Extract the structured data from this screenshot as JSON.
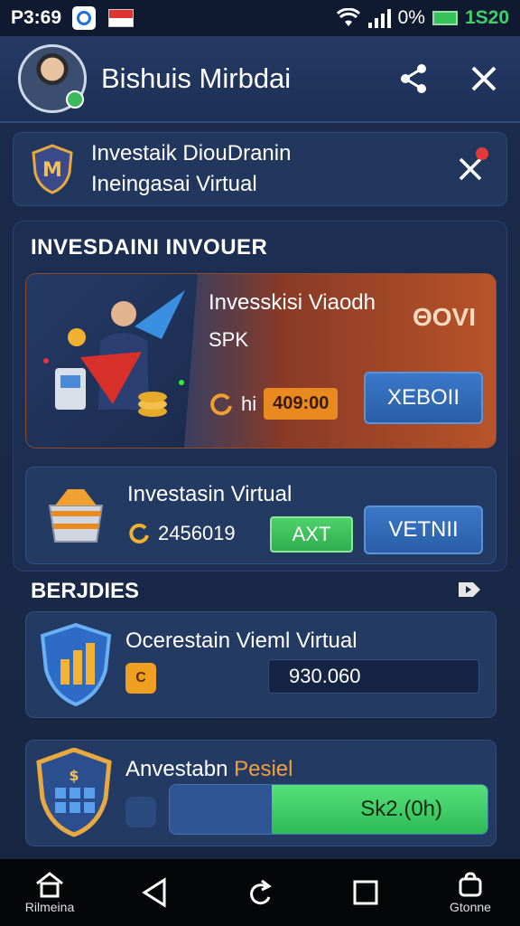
{
  "status_bar": {
    "time": "P3:69",
    "battery_text": "0%",
    "clock_right": "1S20"
  },
  "header": {
    "title": "Bishuis Mirbdai"
  },
  "notice": {
    "line1": "Investaik DiouDranin",
    "line2": "Ineingasai Virtual"
  },
  "section1": {
    "title": "INVESDAINI INVOUER",
    "promo": {
      "name": "Invesskisi Viaodh",
      "sub": "SPK",
      "badge": "ΘOVI",
      "price_prefix": "hi",
      "price": "409:00",
      "button": "XEBOII"
    },
    "invest": {
      "title": "Investasin Virtual",
      "value": "2456019",
      "green_button": "AXT",
      "button": "VETNII"
    }
  },
  "section2": {
    "title": "BERJDIES",
    "card2": {
      "title": "Ocerestain Vieml Virtual",
      "field_value": "930.060"
    },
    "card3": {
      "title_main": "Anvestabn",
      "title_accent": "Pesiel",
      "bar_label": "Sk2.(0h)",
      "bar_fill_fraction": 0.68
    }
  },
  "navbar": {
    "home_label": "Rilmeina",
    "profile_label": "Gtonne"
  },
  "colors": {
    "accent_orange": "#e88a20",
    "accent_green": "#3cc85c",
    "button_blue": "#3b78c8"
  }
}
